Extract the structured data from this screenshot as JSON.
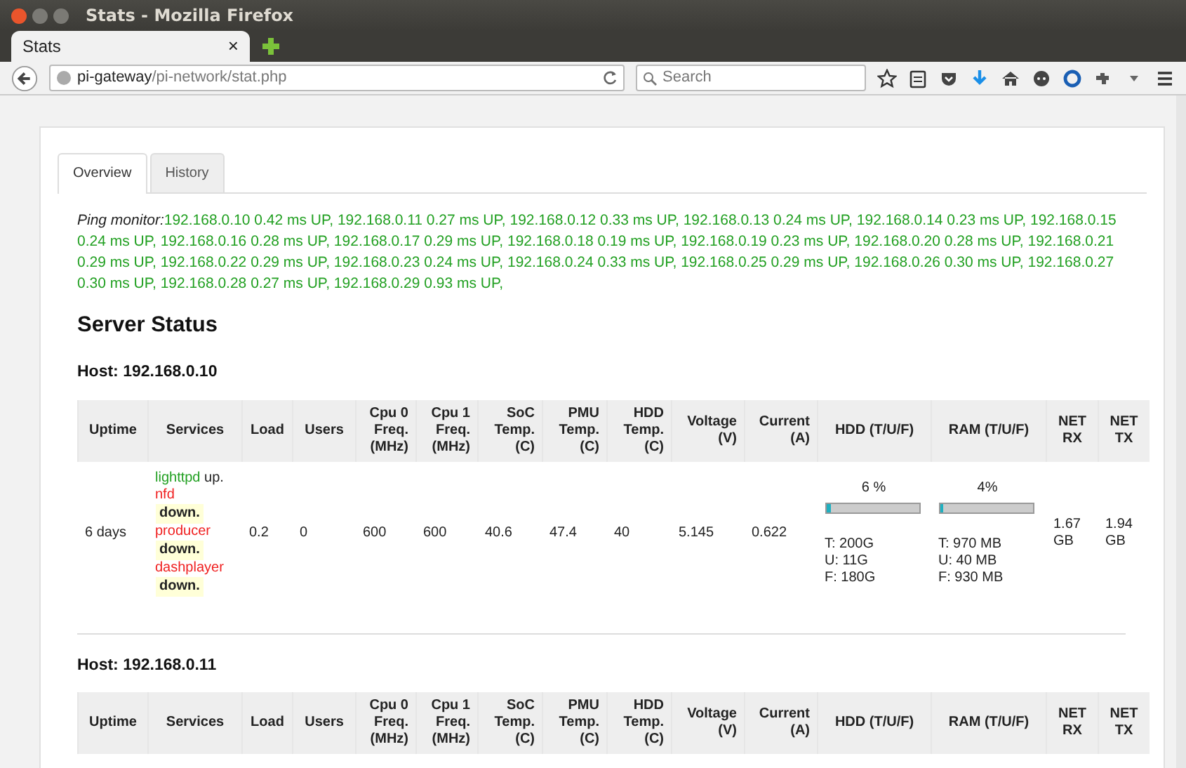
{
  "window": {
    "title": "Stats - Mozilla Firefox"
  },
  "browser": {
    "tab": {
      "title": "Stats",
      "close": "×"
    },
    "url": {
      "host": "pi-gateway",
      "path": "/pi-network/stat.php"
    },
    "search": {
      "placeholder": "Search"
    }
  },
  "tabs": [
    {
      "label": "Overview",
      "selected": true
    },
    {
      "label": "History",
      "selected": false
    }
  ],
  "ping": {
    "label": "Ping monitor:",
    "entries": [
      {
        "text": "192.168.0.10 0.42 ms UP,",
        "up": true
      },
      {
        "text": "192.168.0.11 0.27 ms UP,",
        "up": true
      },
      {
        "text": "192.168.0.12 0.33 ms UP,",
        "up": true
      },
      {
        "text": "192.168.0.13 0.24 ms UP,",
        "up": true
      },
      {
        "text": "192.168.0.14 0.23 ms UP,",
        "up": true
      },
      {
        "text": "192.168.0.15 0.24 ms UP,",
        "up": true
      },
      {
        "text": "192.168.0.16 0.28 ms UP,",
        "up": true
      },
      {
        "text": "192.168.0.17 0.29 ms UP,",
        "up": true
      },
      {
        "text": "192.168.0.18 0.19 ms UP,",
        "up": true
      },
      {
        "text": "192.168.0.19 0.23 ms UP,",
        "up": true
      },
      {
        "text": "192.168.0.20 0.28 ms UP,",
        "up": true
      },
      {
        "text": "192.168.0.21 0.29 ms UP,",
        "up": true
      },
      {
        "text": "192.168.0.22 0.29 ms UP,",
        "up": true
      },
      {
        "text": "192.168.0.23 0.24 ms UP,",
        "up": true
      },
      {
        "text": "192.168.0.24 0.33 ms UP,",
        "up": true
      },
      {
        "text": "192.168.0.25 0.29 ms UP,",
        "up": true
      },
      {
        "text": "192.168.0.26 0.30 ms UP,",
        "up": true
      },
      {
        "text": "192.168.0.27 0.30 ms UP,",
        "up": true
      },
      {
        "text": "192.168.0.28 0.27 ms UP,",
        "up": true
      },
      {
        "text": "192.168.0.29 0.93 ms UP,",
        "up": true
      }
    ]
  },
  "heading": "Server Status",
  "hosts": [
    {
      "title": "Host: 192.168.0.10",
      "columns": [
        "Uptime",
        "Services",
        "Load",
        "Users",
        "Cpu 0 Freq. (MHz)",
        "Cpu 1 Freq. (MHz)",
        "SoC Temp. (C)",
        "PMU Temp. (C)",
        "HDD Temp. (C)",
        "Voltage (V)",
        "Current (A)",
        "HDD (T/U/F)",
        "RAM (T/U/F)",
        "NET RX",
        "NET TX"
      ],
      "rows": [
        [
          {
            "kind": "text",
            "text": "6 days"
          },
          {
            "kind": "services",
            "services": [
              {
                "name": "lighttpd",
                "up": true,
                "status": "up."
              },
              {
                "name": "nfd",
                "up": false,
                "status": "down."
              },
              {
                "name": "producer",
                "up": false,
                "status": "down."
              },
              {
                "name": "dashplayer",
                "up": false,
                "status": "down."
              }
            ]
          },
          {
            "kind": "text",
            "text": "0.2"
          },
          {
            "kind": "text",
            "text": "0"
          },
          {
            "kind": "text",
            "text": "600"
          },
          {
            "kind": "text",
            "text": "600"
          },
          {
            "kind": "text",
            "text": "40.6"
          },
          {
            "kind": "text",
            "text": "47.4"
          },
          {
            "kind": "text",
            "text": "40"
          },
          {
            "kind": "text",
            "text": "5.145"
          },
          {
            "kind": "text",
            "text": "0.622"
          },
          {
            "kind": "usage",
            "percent": "6 %",
            "level": 0.06,
            "lines": [
              "T: 200G",
              "U: 11G",
              "F: 180G"
            ]
          },
          {
            "kind": "usage",
            "percent": "4%",
            "level": 0.04,
            "lines": [
              "T: 970 MB",
              "U: 40 MB",
              "F: 930 MB"
            ]
          },
          {
            "kind": "text",
            "text": "1.67 GB"
          },
          {
            "kind": "text",
            "text": "1.94 GB"
          }
        ]
      ]
    },
    {
      "title": "Host: 192.168.0.11",
      "columns": [
        "Uptime",
        "Services",
        "Load",
        "Users",
        "Cpu 0 Freq. (MHz)",
        "Cpu 1 Freq. (MHz)",
        "SoC Temp. (C)",
        "PMU Temp. (C)",
        "HDD Temp. (C)",
        "Voltage (V)",
        "Current (A)",
        "HDD (T/U/F)",
        "RAM (T/U/F)",
        "NET RX",
        "NET TX"
      ]
    }
  ]
}
